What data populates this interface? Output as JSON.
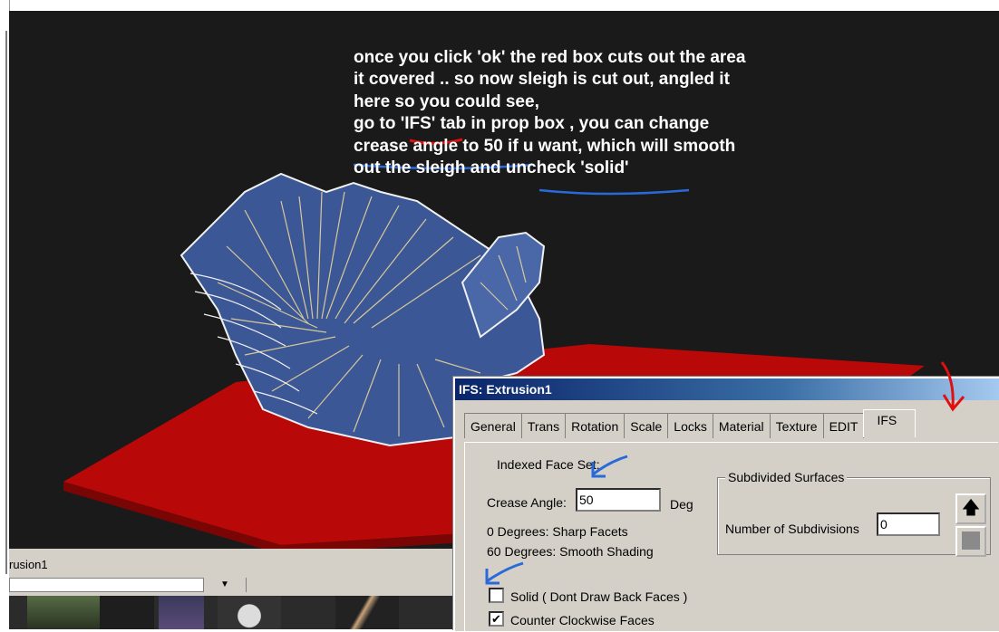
{
  "annotation": {
    "lines": [
      "once you click 'ok' the red box cuts out the area",
      "it covered .. so now sleigh is cut out, angled it",
      "here so you could see,",
      "go to 'IFS' tab in prop box ,  you can change",
      "crease angle to 50 if u want, which will smooth",
      "out the sleigh and uncheck 'solid'"
    ]
  },
  "bottom_panel": {
    "name_label": "rusion1",
    "dropdown_glyph": "▼"
  },
  "dialog": {
    "title": "IFS:  Extrusion1",
    "tabs": [
      "General",
      "Trans",
      "Rotation",
      "Scale",
      "Locks",
      "Material",
      "Texture",
      "EDIT",
      "IFS"
    ],
    "active_tab": "IFS",
    "indexed_face_set_label": "Indexed Face Set:",
    "crease_angle_label": "Crease Angle:",
    "crease_angle_value": "50",
    "crease_angle_unit": "Deg",
    "hint_sharp": "0 Degrees: Sharp Facets",
    "hint_smooth": "60 Degrees: Smooth Shading",
    "subdivided_title": "Subdivided Surfaces",
    "subdivisions_label": "Number of Subdivisions",
    "subdivisions_value": "0",
    "solid_label": "Solid  ( Dont Draw Back Faces )",
    "solid_checked": false,
    "ccw_label": "Counter Clockwise Faces",
    "ccw_checked": true
  },
  "colors": {
    "viewport_bg": "#1a1a1a",
    "base_red": "#c40a0a",
    "sleigh_blue": "#3c5a9a",
    "wire": "#d8c89a",
    "annotation_red": "#e01010",
    "annotation_blue": "#2a6ad8"
  },
  "icons": [
    "up-arrow-icon",
    "square-icon",
    "red-arrow-icon",
    "blue-arrow-icon",
    "checkmark-icon"
  ]
}
